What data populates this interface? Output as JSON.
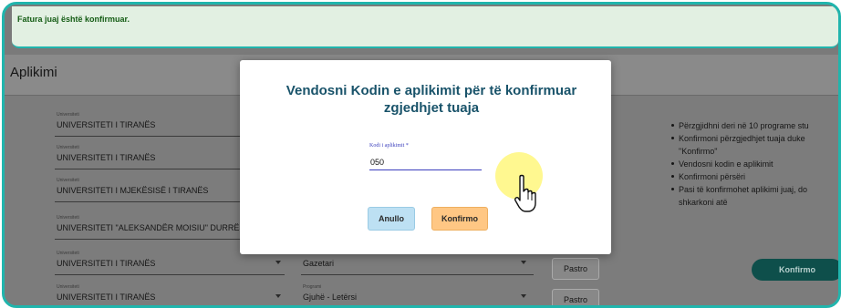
{
  "banner": {
    "text": "Fatura juaj është konfirmuar."
  },
  "header": {
    "title": "Aplikimi"
  },
  "choices": [
    {
      "university_label": "Universiteti",
      "university": "UNIVERSITETI I TIRANËS"
    },
    {
      "university_label": "Universiteti",
      "university": "UNIVERSITETI I TIRANËS"
    },
    {
      "university_label": "Universiteti",
      "university": "UNIVERSITETI I MJEKËSISË I TIRANËS"
    },
    {
      "university_label": "Universiteti",
      "university": "UNIVERSITETI \"ALEKSANDËR MOISIU\" DURRËS"
    },
    {
      "university_label": "Universiteti",
      "university": "UNIVERSITETI I TIRANËS",
      "program_label": "",
      "program": "Gazetari",
      "clear_label": "Pastro"
    },
    {
      "university_label": "Universiteti",
      "university": "UNIVERSITETI I TIRANËS",
      "program_label": "Programi",
      "program": "Gjuhë - Letërsi",
      "clear_label": "Pastro"
    }
  ],
  "instructions": [
    "Përzgjidhni deri në 10 programe stu",
    "Konfirmoni përzgjedhjet tuaja duke",
    "\"Konfirmo\"",
    "Vendosni kodin e aplikimit",
    "Konfirmoni përsëri",
    "Pasi të konfirmohet aplikimi juaj, do",
    "shkarkoni atë"
  ],
  "background_confirm_label": "Konfirmo",
  "modal": {
    "title": "Vendosni Kodin e aplikimit për të konfirmuar zgjedhjet tuaja",
    "code_label": "Kodi i aplikimit *",
    "code_value": "050",
    "cancel_label": "Anullo",
    "confirm_label": "Konfirmo"
  },
  "colors": {
    "accent": "#20b5ad",
    "title": "#19536a",
    "cancel_button": "#bde0f3",
    "confirm_button": "#ffc784",
    "input_underline": "#3b3fbd"
  },
  "icons": {
    "dropdown": "chevron-down-icon",
    "cursor": "pointer-hand-icon"
  }
}
